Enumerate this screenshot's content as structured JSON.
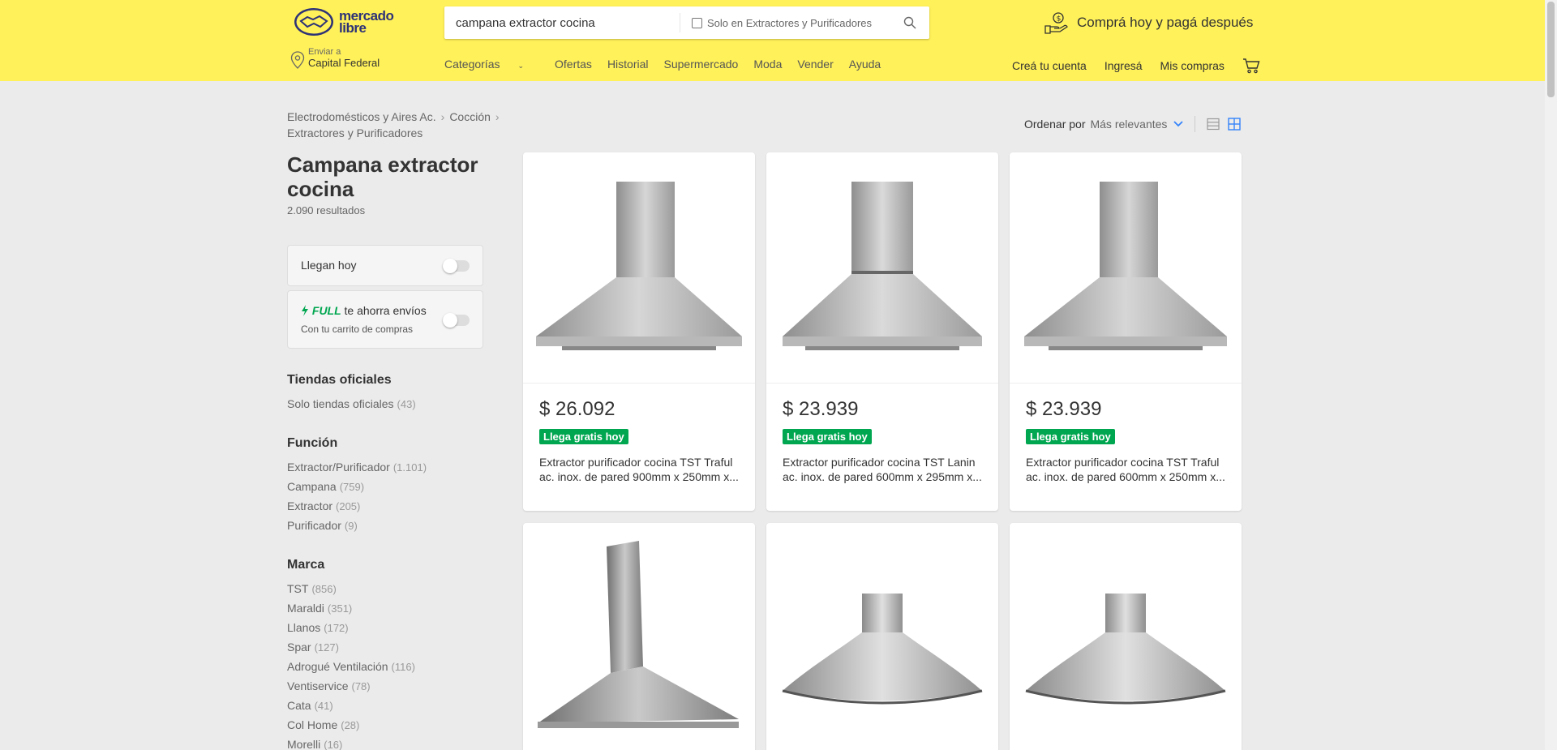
{
  "header": {
    "logo_line1": "mercado",
    "logo_line2": "libre",
    "search": {
      "value": "campana extractor cocina",
      "checkbox_label": "Solo en Extractores y Purificadores"
    },
    "promo": "Comprá hoy y pagá después",
    "ship": {
      "small": "Enviar a",
      "big": "Capital Federal"
    },
    "nav": [
      "Categorías",
      "Ofertas",
      "Historial",
      "Supermercado",
      "Moda",
      "Vender",
      "Ayuda"
    ],
    "user_nav": [
      "Creá tu cuenta",
      "Ingresá",
      "Mis compras"
    ]
  },
  "breadcrumb": [
    "Electrodomésticos y Aires Ac.",
    "Cocción",
    "Extractores y Purificadores"
  ],
  "sort": {
    "label": "Ordenar por",
    "value": "Más relevantes"
  },
  "search_title": "Campana extractor cocina",
  "results": "2.090 resultados",
  "filters_toggle": {
    "llegan_hoy": "Llegan hoy",
    "full_mark": "FULL",
    "full_text": "te ahorra envíos",
    "full_sub": "Con tu carrito de compras"
  },
  "filter_groups": [
    {
      "title": "Tiendas oficiales",
      "items": [
        {
          "label": "Solo tiendas oficiales",
          "count": "(43)"
        }
      ]
    },
    {
      "title": "Función",
      "items": [
        {
          "label": "Extractor/Purificador",
          "count": "(1.101)"
        },
        {
          "label": "Campana",
          "count": "(759)"
        },
        {
          "label": "Extractor",
          "count": "(205)"
        },
        {
          "label": "Purificador",
          "count": "(9)"
        }
      ]
    },
    {
      "title": "Marca",
      "items": [
        {
          "label": "TST",
          "count": "(856)"
        },
        {
          "label": "Maraldi",
          "count": "(351)"
        },
        {
          "label": "Llanos",
          "count": "(172)"
        },
        {
          "label": "Spar",
          "count": "(127)"
        },
        {
          "label": "Adrogué Ventilación",
          "count": "(116)"
        },
        {
          "label": "Ventiservice",
          "count": "(78)"
        },
        {
          "label": "Cata",
          "count": "(41)"
        },
        {
          "label": "Col Home",
          "count": "(28)"
        },
        {
          "label": "Morelli",
          "count": "(16)"
        }
      ]
    }
  ],
  "products": [
    {
      "price": "$ 26.092",
      "badge": "Llega gratis hoy",
      "title": "Extractor purificador cocina TST Traful ac. inox. de pared 900mm x 250mm x..."
    },
    {
      "price": "$ 23.939",
      "badge": "Llega gratis hoy",
      "title": "Extractor purificador cocina TST Lanin ac. inox. de pared 600mm x 295mm x..."
    },
    {
      "price": "$ 23.939",
      "badge": "Llega gratis hoy",
      "title": "Extractor purificador cocina TST Traful ac. inox. de pared 600mm x 250mm x..."
    }
  ],
  "colors": {
    "header_bg": "#fff159",
    "accent_blue": "#3483fa",
    "success_green": "#00a650"
  }
}
